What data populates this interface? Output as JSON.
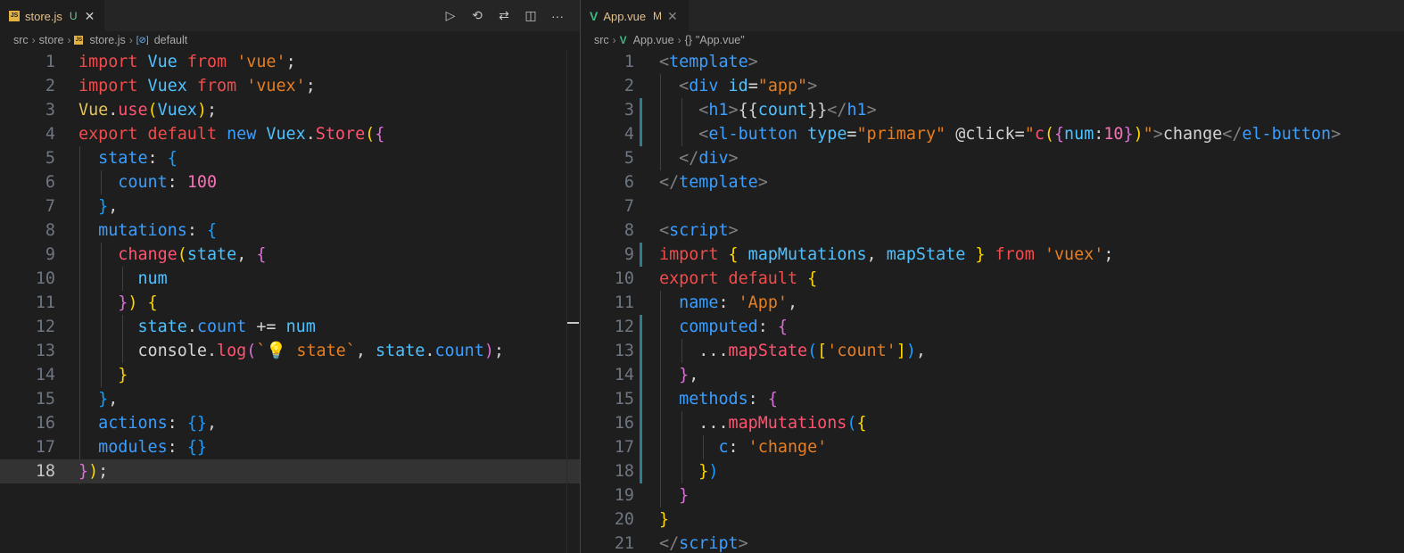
{
  "left": {
    "tab": {
      "label": "store.js",
      "status": "U"
    },
    "breadcrumb": [
      "src",
      "store",
      "store.js",
      "default"
    ],
    "actions": [
      "run-icon",
      "history-icon",
      "compare-icon",
      "split-icon",
      "more-icon"
    ],
    "line_numbers": [
      "1",
      "2",
      "3",
      "4",
      "5",
      "6",
      "7",
      "8",
      "9",
      "10",
      "11",
      "12",
      "13",
      "14",
      "15",
      "16",
      "17",
      "18"
    ],
    "active_line": "18"
  },
  "right": {
    "tab": {
      "label": "App.vue",
      "status": "M"
    },
    "breadcrumb": [
      "src",
      "App.vue",
      "\"App.vue\""
    ],
    "breadcrumb_prefix": "{}",
    "line_numbers": [
      "1",
      "2",
      "3",
      "4",
      "5",
      "6",
      "7",
      "8",
      "9",
      "10",
      "11",
      "12",
      "13",
      "14",
      "15",
      "16",
      "17",
      "18",
      "19",
      "20",
      "21"
    ]
  },
  "colors": {
    "background": "#1e1e1e",
    "tabbar": "#252526",
    "current_line": "#333333",
    "git_gutter": "#2d7f8f"
  }
}
